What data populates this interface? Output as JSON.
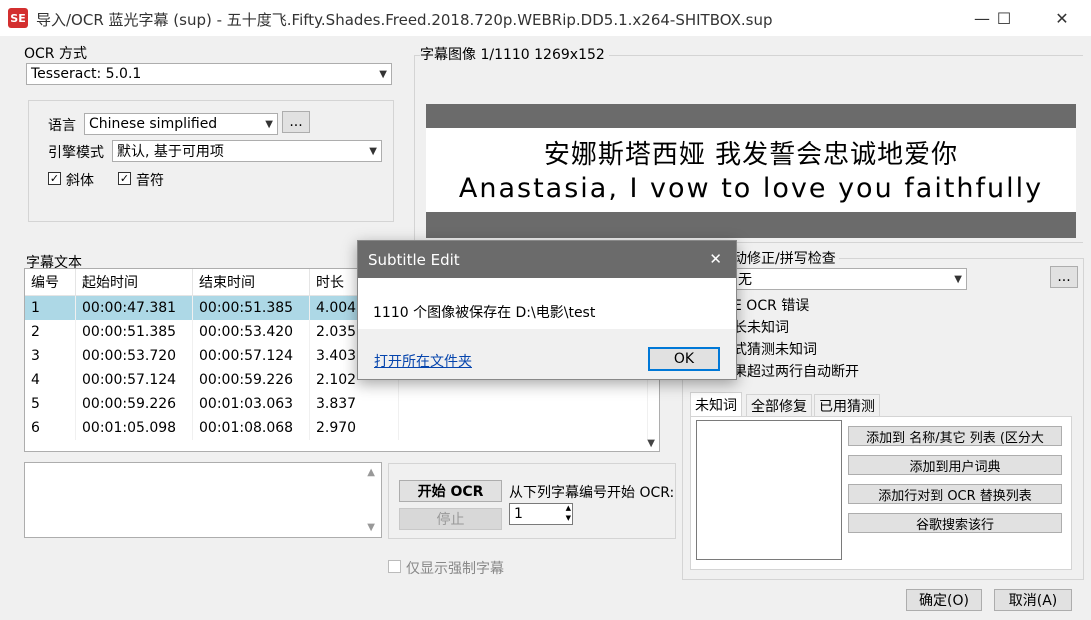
{
  "window": {
    "title": "导入/OCR 蓝光字幕 (sup) - 五十度飞.Fifty.Shades.Freed.2018.720p.WEBRip.DD5.1.x264-SHITBOX.sup",
    "icon_text": "SE",
    "minimize": "—",
    "maximize": "☐",
    "close": "✕"
  },
  "ocr": {
    "group_title": "OCR 方式",
    "method": "Tesseract: 5.0.1",
    "language_label": "语言",
    "language": "Chinese simplified",
    "language_more": "...",
    "engine_label": "引擎模式",
    "engine": "默认, 基于可用项",
    "italic_label": "斜体",
    "italic_checked": true,
    "music_label": "音符",
    "music_checked": true
  },
  "image": {
    "header": "字幕图像 1/1110   1269x152",
    "line1": "安娜斯塔西娅 我发誓会忠诚地爱你",
    "line2": "Anastasia, I vow to love you faithfully"
  },
  "subtitle_text": {
    "group_title": "字幕文本",
    "columns": [
      "编号",
      "起始时间",
      "结束时间",
      "时长"
    ],
    "rows": [
      {
        "num": "1",
        "start": "00:00:47.381",
        "end": "00:00:51.385",
        "dur": "4.004"
      },
      {
        "num": "2",
        "start": "00:00:51.385",
        "end": "00:00:53.420",
        "dur": "2.035"
      },
      {
        "num": "3",
        "start": "00:00:53.720",
        "end": "00:00:57.124",
        "dur": "3.403"
      },
      {
        "num": "4",
        "start": "00:00:57.124",
        "end": "00:00:59.226",
        "dur": "2.102"
      },
      {
        "num": "5",
        "start": "00:00:59.226",
        "end": "00:01:03.063",
        "dur": "3.837"
      },
      {
        "num": "6",
        "start": "00:01:05.098",
        "end": "00:01:08.068",
        "dur": "2.970"
      }
    ]
  },
  "controls": {
    "start_ocr": "开始 OCR",
    "stop": "停止",
    "start_from_label": "从下列字幕编号开始 OCR:",
    "start_from_value": "1",
    "forced_only": "仅显示强制字幕"
  },
  "spellcheck": {
    "title": "动修正/拼写检查",
    "dictionary": "无",
    "more": "...",
    "opt1": "E OCR 错误",
    "opt2": "长未知词",
    "opt3": "式猜测未知词",
    "opt4": "果超过两行自动断开",
    "tabs": [
      "未知词",
      "全部修复",
      "已用猜测"
    ],
    "buttons": [
      "添加到 名称/其它 列表 (区分大",
      "添加到用户词典",
      "添加行对到 OCR 替换列表",
      "谷歌搜索该行"
    ]
  },
  "footer": {
    "ok": "确定(O)",
    "cancel": "取消(A)"
  },
  "dialog": {
    "title": "Subtitle Edit",
    "close": "✕",
    "message": "1110 个图像被保存在 D:\\电影\\test",
    "link": "打开所在文件夹",
    "ok": "OK"
  }
}
